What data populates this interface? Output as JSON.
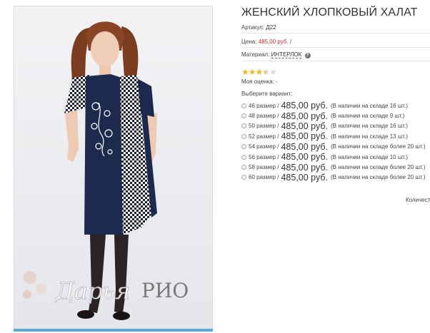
{
  "product": {
    "title": "ЖЕНСКИЙ ХЛОПКОВЫЙ ХАЛАТ",
    "article_label": "Артикул:",
    "article_value": "Д22",
    "price_label": "Цена:",
    "price_value": "485,00 руб.",
    "price_sep": "/",
    "material_label": "Материал:",
    "material_value": "ИНТЕРЛОК",
    "help_glyph": "?",
    "rating": {
      "value": 3.5,
      "max": 5,
      "filled_color": "#f2b51c",
      "empty_color": "#d9d9d9"
    },
    "my_rating_label": "Моя оценка:",
    "my_rating_value": "-",
    "choose_label": "Выберите вариант:"
  },
  "image": {
    "watermark_name": "Дарья",
    "watermark_brand": "РИО"
  },
  "variants": [
    {
      "size": "46 размер",
      "sep": "/",
      "price": "485,00 руб.",
      "stock": "(В наличии на складе 16 шт.)"
    },
    {
      "size": "48 размер",
      "sep": "/",
      "price": "485,00 руб.",
      "stock": "(В наличии на складе 9 шт.)"
    },
    {
      "size": "50 размер",
      "sep": "/",
      "price": "485,00 руб.",
      "stock": "(В наличии на складе 16 шт.)"
    },
    {
      "size": "52 размер",
      "sep": "/",
      "price": "485,00 руб.",
      "stock": "(В наличии на складе 13 шт.)"
    },
    {
      "size": "54 размер",
      "sep": "/",
      "price": "485,00 руб.",
      "stock": "(В наличии на складе более 20 шт.)"
    },
    {
      "size": "56 размер",
      "sep": "/",
      "price": "485,00 руб.",
      "stock": "(В наличии на складе 10 шт.)"
    },
    {
      "size": "58 размер",
      "sep": "/",
      "price": "485,00 руб.",
      "stock": "(В наличии на складе более 20 шт.)"
    },
    {
      "size": "60 размер",
      "sep": "/",
      "price": "485,00 руб.",
      "stock": "(В наличии на складе более 20 шт.)"
    }
  ],
  "quantity_label": "Количество:",
  "colors": {
    "price_red": "#c62d2d",
    "navy": "#1c2a4e",
    "accent_blue": "#5aa9d8"
  }
}
